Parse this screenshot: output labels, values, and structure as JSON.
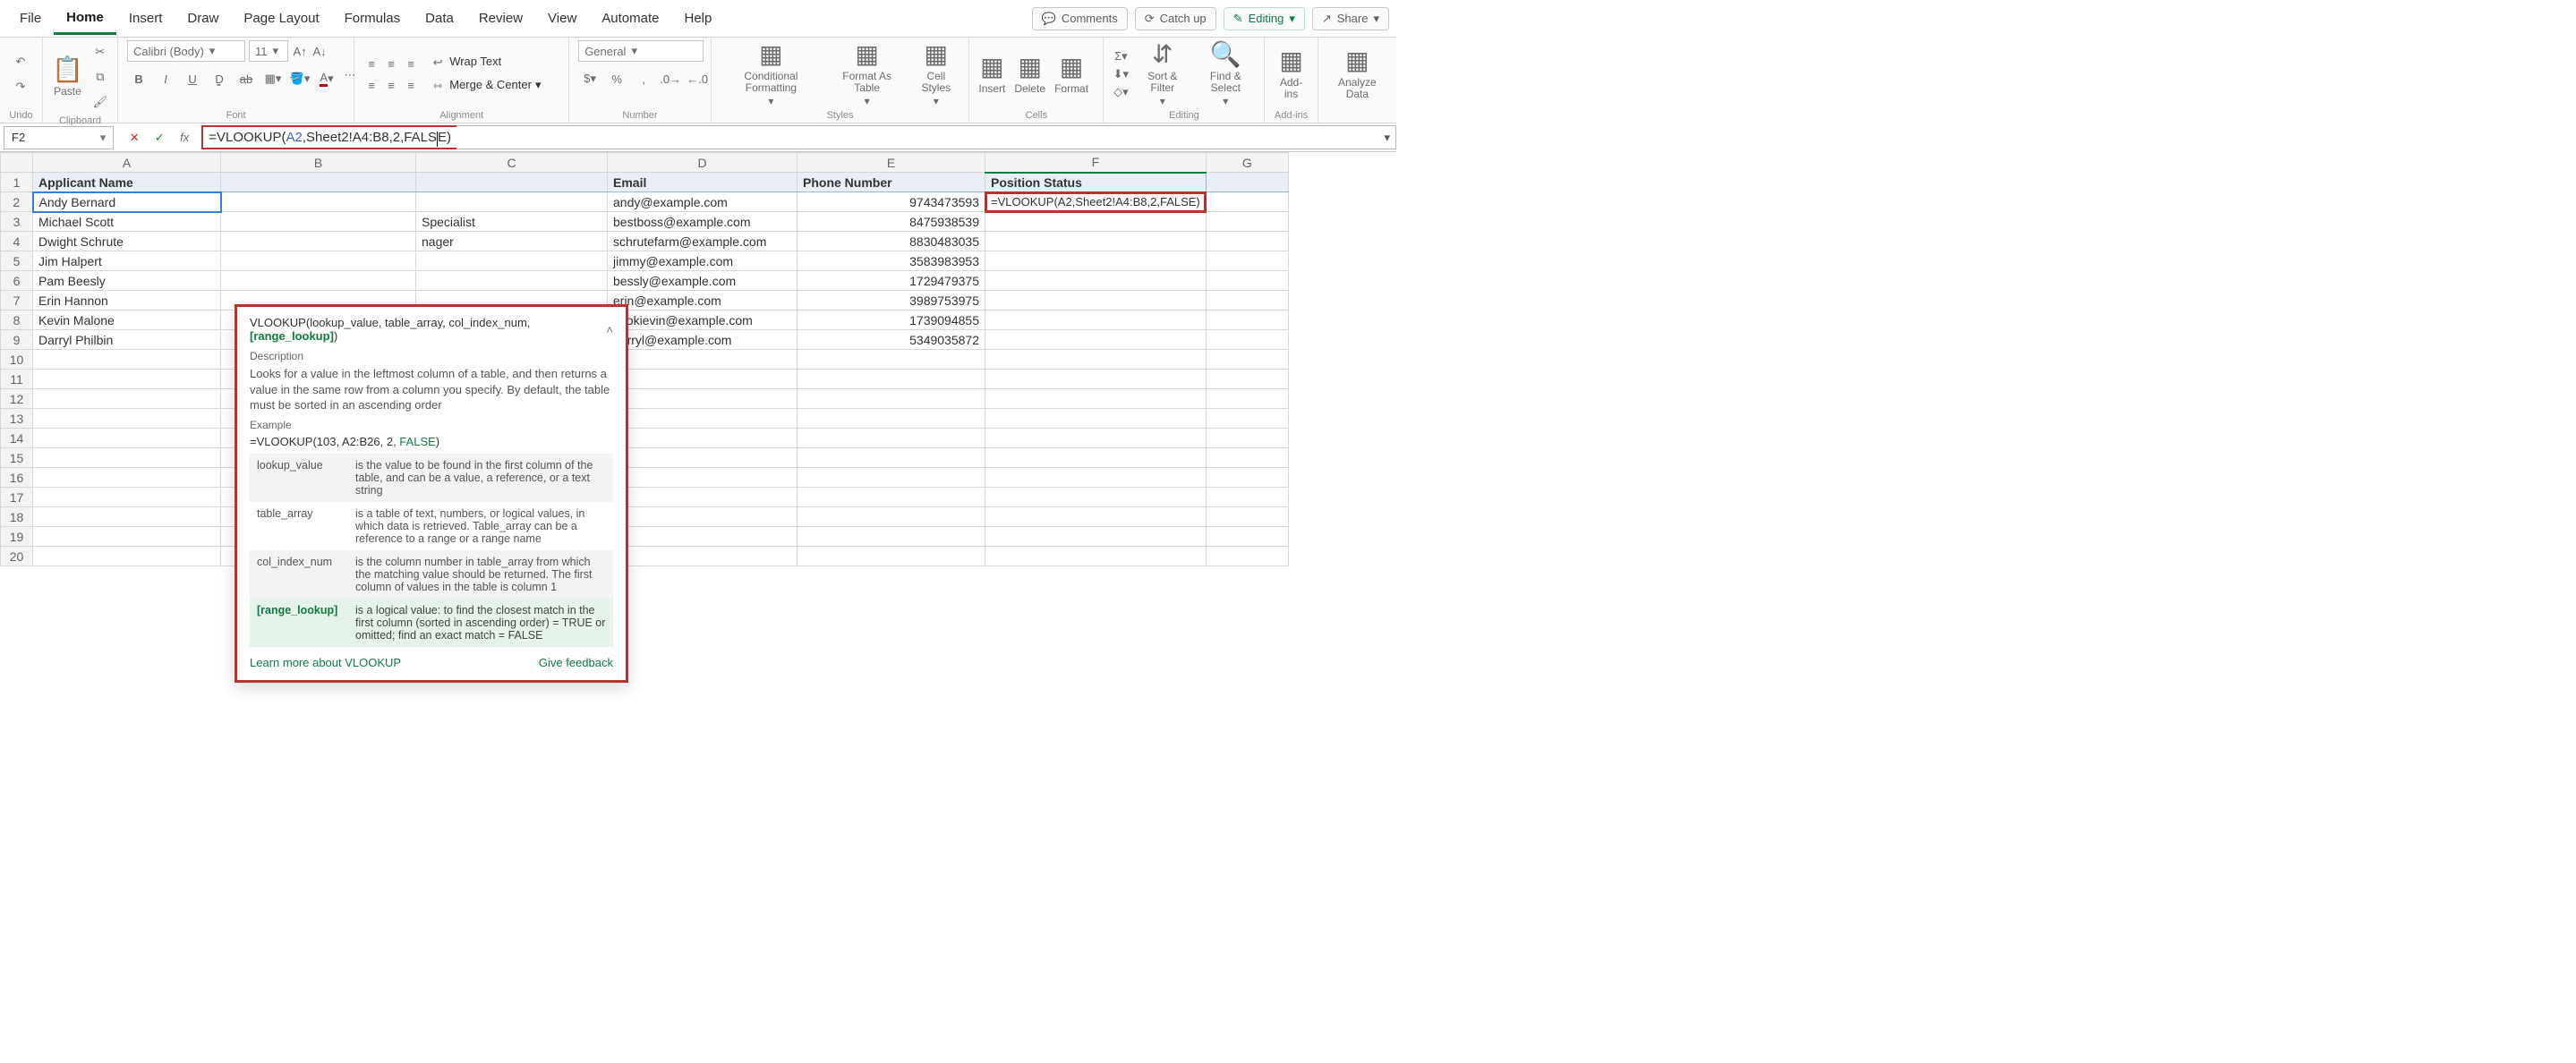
{
  "menubar": {
    "items": [
      "File",
      "Home",
      "Insert",
      "Draw",
      "Page Layout",
      "Formulas",
      "Data",
      "Review",
      "View",
      "Automate",
      "Help"
    ],
    "active_index": 1,
    "right_buttons": [
      {
        "icon": "comment-icon",
        "label": "Comments"
      },
      {
        "icon": "catchup-icon",
        "label": "Catch up"
      },
      {
        "icon": "pencil-icon",
        "label": "Editing",
        "style": "editing",
        "dropdown": true
      },
      {
        "icon": "share-icon",
        "label": "Share",
        "dropdown": true
      }
    ]
  },
  "ribbon": {
    "groups": {
      "undo": {
        "label": "Undo"
      },
      "clipboard": {
        "label": "Clipboard",
        "paste_label": "Paste"
      },
      "font": {
        "label": "Font",
        "font_name": "Calibri (Body)",
        "font_size": "11"
      },
      "alignment": {
        "label": "Alignment",
        "wrap_text": "Wrap Text",
        "merge_center": "Merge & Center"
      },
      "number": {
        "label": "Number",
        "format": "General"
      },
      "styles": {
        "label": "Styles",
        "cond_fmt": "Conditional Formatting",
        "fmt_table": "Format As Table",
        "cell_styles": "Cell Styles"
      },
      "cells": {
        "label": "Cells",
        "insert": "Insert",
        "delete": "Delete",
        "format": "Format"
      },
      "editing": {
        "label": "Editing",
        "sort_filter": "Sort & Filter",
        "find_select": "Find & Select"
      },
      "addins": {
        "label": "Add-ins",
        "btn": "Add-ins"
      },
      "analyze": {
        "label": "",
        "btn": "Analyze Data"
      }
    }
  },
  "namebox": {
    "value": "F2"
  },
  "formula_bar": {
    "prefix": "=VLOOKUP(",
    "arg_ref": "A2",
    "mid": ",Sheet2!A4:B8,2,",
    "kw": "FALS",
    "kw_tail": "E",
    "suffix": ")"
  },
  "active_cell_formula": "=VLOOKUP(A2,Sheet2!A4:B8,2,FALSE)",
  "tooltip": {
    "signature": {
      "fn": "VLOOKUP",
      "args": "(lookup_value, table_array, col_index_num, ",
      "current": "[range_lookup]",
      "close": ")"
    },
    "desc_title": "Description",
    "desc_body": "Looks for a value in the leftmost column of a table, and then returns a value in the same row from a column you specify. By default, the table must be sorted in an ascending order",
    "example_title": "Example",
    "example_prefix": "=VLOOKUP(103, A2:B26, 2, ",
    "example_kw": "FALSE",
    "example_suffix": ")",
    "params": [
      {
        "name": "lookup_value",
        "desc": "is the value to be found in the first column of the table, and can be a value, a reference, or a text string",
        "alt": true
      },
      {
        "name": "table_array",
        "desc": "is a table of text, numbers, or logical values, in which data is retrieved. Table_array can be a reference to a range or a range name"
      },
      {
        "name": "col_index_num",
        "desc": "is the column number in table_array from which the matching value should be returned. The first column of values in the table is column 1",
        "alt": true
      },
      {
        "name": "[range_lookup]",
        "desc": "is a logical value: to find the closest match in the first column (sorted in ascending order) = TRUE or omitted; find an exact match = FALSE",
        "selected": true
      }
    ],
    "learn_more": "Learn more about VLOOKUP",
    "give_feedback": "Give feedback"
  },
  "columns": [
    "A",
    "B",
    "C",
    "D",
    "E",
    "F",
    "G"
  ],
  "header_row": {
    "A": "Applicant Name",
    "D": "Email",
    "E": "Phone Number",
    "F": "Position Status"
  },
  "rows": [
    {
      "n": 2,
      "A": "Andy Bernard",
      "C_tail": "",
      "D": "andy@example.com",
      "E": "9743473593",
      "F_formula": true
    },
    {
      "n": 3,
      "A": "Michael Scott",
      "C_tail": "Specialist",
      "D": "bestboss@example.com",
      "E": "8475938539"
    },
    {
      "n": 4,
      "A": "Dwight Schrute",
      "C_tail": "nager",
      "D": "schrutefarm@example.com",
      "E": "8830483035"
    },
    {
      "n": 5,
      "A": "Jim Halpert",
      "C_tail": "",
      "D": "jimmy@example.com",
      "E": "3583983953"
    },
    {
      "n": 6,
      "A": "Pam Beesly",
      "C_tail": "",
      "D": "bessly@example.com",
      "E": "1729479375"
    },
    {
      "n": 7,
      "A": "Erin Hannon",
      "C_tail": "",
      "D": "erin@example.com",
      "E": "3989753975"
    },
    {
      "n": 8,
      "A": "Kevin Malone",
      "C_tail": "",
      "D": "cookievin@example.com",
      "E": "1739094855"
    },
    {
      "n": 9,
      "A": "Darryl Philbin",
      "C_tail": "",
      "D": "darryl@example.com",
      "E": "5349035872"
    }
  ],
  "empty_rows": [
    10,
    11,
    12,
    13,
    14,
    15,
    16,
    17,
    18,
    19,
    20
  ]
}
